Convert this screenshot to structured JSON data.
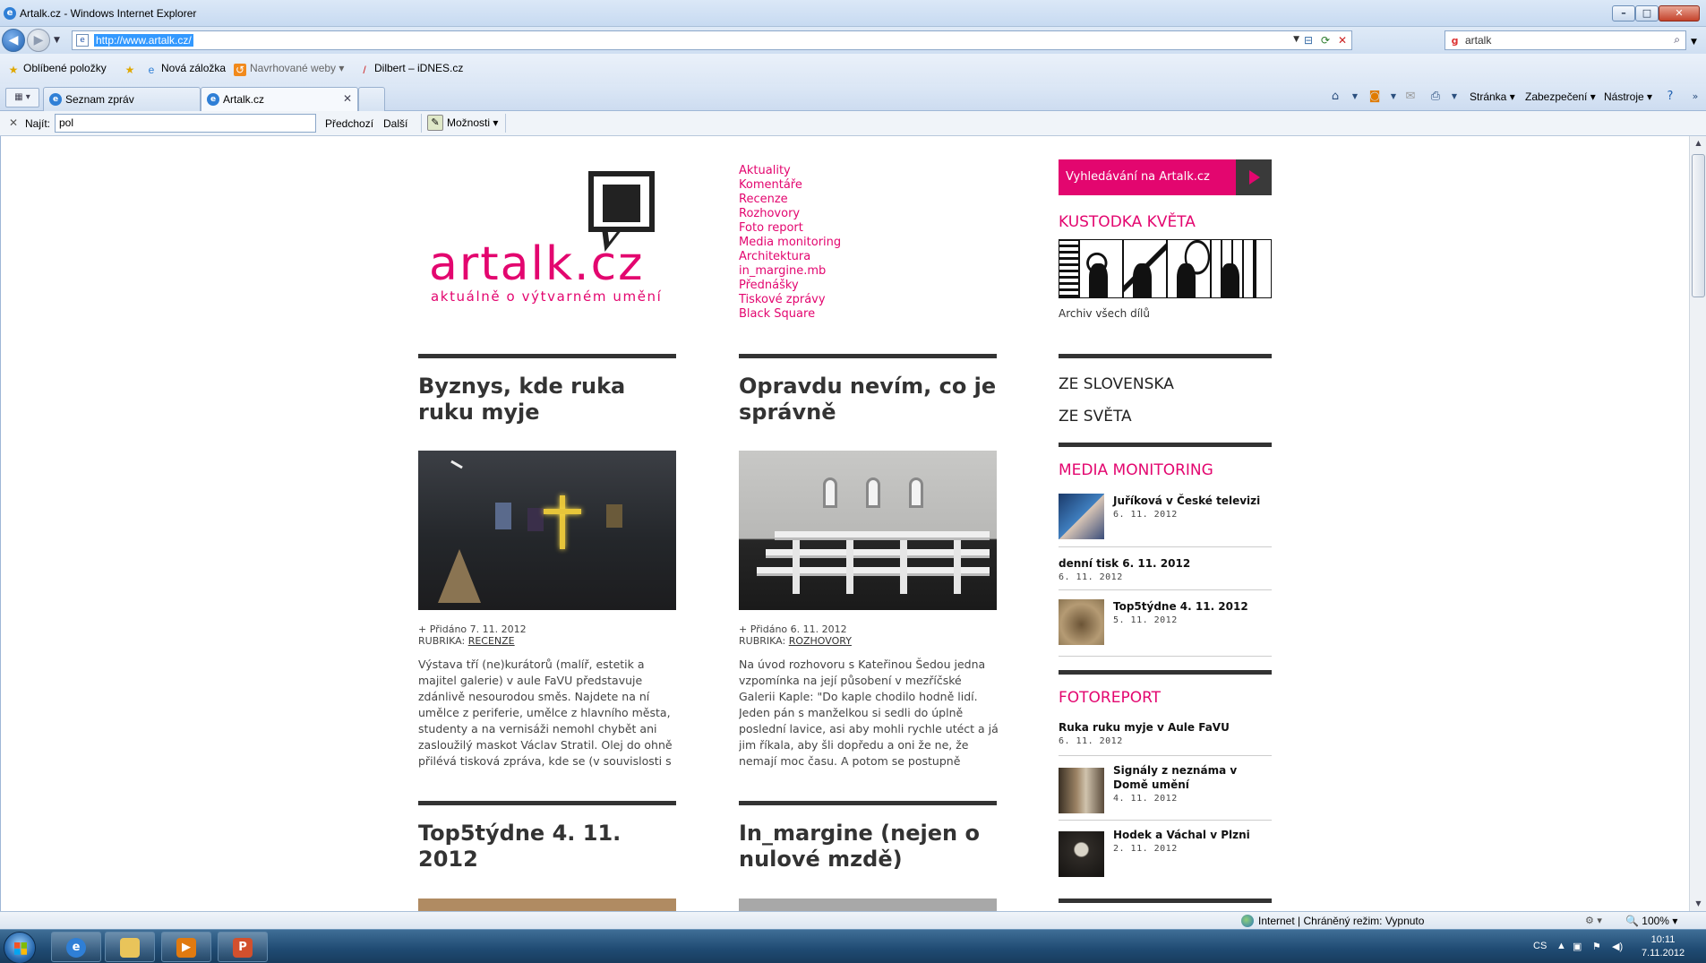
{
  "window": {
    "title": "Artalk.cz - Windows Internet Explorer"
  },
  "address": {
    "url": "http://www.artalk.cz/"
  },
  "search": {
    "value": "artalk"
  },
  "favorites": {
    "items": [
      {
        "label": "Oblíbené položky"
      },
      {
        "label": "Nová záložka"
      },
      {
        "label": "Navrhované weby"
      },
      {
        "label": "Dilbert – iDNES.cz"
      }
    ]
  },
  "tabs": [
    {
      "label": "Seznam zpráv"
    },
    {
      "label": "Artalk.cz"
    }
  ],
  "commandbar": {
    "page": "Stránka",
    "security": "Zabezpečení",
    "tools": "Nástroje"
  },
  "find": {
    "label": "Najít:",
    "value": "pol",
    "prev": "Předchozí",
    "next": "Další",
    "options": "Možnosti"
  },
  "site": {
    "logo": "artalk.cz",
    "tagline": "aktuálně o výtvarném umění",
    "nav": [
      "Aktuality",
      "Komentáře",
      "Recenze",
      "Rozhovory",
      "Foto report",
      "Media monitoring",
      "Architektura",
      "in_margine.mb",
      "Přednášky",
      "Tiskové zprávy",
      "Black Square"
    ],
    "search_label": "Vyhledávání na Artalk.cz",
    "kustodka": {
      "title": "KUSTODKA KVĚTA",
      "archive": "Archiv všech dílů"
    },
    "regions": [
      "ZE SLOVENSKA",
      "ZE SVĚTA"
    ],
    "media_monitoring": {
      "title": "MEDIA MONITORING",
      "items": [
        {
          "title": "Juříková v České televizi",
          "date": "6. 11. 2012"
        },
        {
          "title": "denní tisk 6. 11. 2012",
          "date": "6. 11. 2012"
        },
        {
          "title": "Top5týdne 4. 11. 2012",
          "date": "5. 11. 2012"
        }
      ]
    },
    "fotoreport": {
      "title": "FOTOREPORT",
      "items": [
        {
          "title": "Ruka ruku myje v Aule FaVU",
          "date": "6. 11. 2012"
        },
        {
          "title": "Signály z neznáma v Domě umění",
          "date": "4. 11. 2012"
        },
        {
          "title": "Hodek a Váchal v Plzni",
          "date": "2. 11. 2012"
        }
      ]
    },
    "articles": [
      {
        "title": "Byznys, kde ruka ruku myje",
        "added": "+ Přidáno 7. 11. 2012",
        "rubrika_label": "RUBRIKA:",
        "rubrika": "RECENZE",
        "text": "Výstava tří (ne)kurátorů (malíř, estetik a majitel galerie) v aule FaVU představuje zdánlivě nesourodou směs. Najdete na ní umělce z periferie, umělce z hlavního města, studenty a na vernisáži nemohl chybět ani zasloužilý maskot Václav Stratil. Olej do ohně přilévá tisková zpráva, kde se (v souvislosti s"
      },
      {
        "title": "Opravdu nevím, co je správně",
        "added": "+ Přidáno 6. 11. 2012",
        "rubrika_label": "RUBRIKA:",
        "rubrika": "ROZHOVORY",
        "text": "Na úvod rozhovoru s Kateřinou Šedou jedna vzpomínka na její působení v mezříčské Galerii Kaple: \"Do kaple chodilo hodně lidí. Jeden pán s manželkou si sedli do úplně poslední lavice, asi aby mohli rychle utéct a já jim říkala, aby šli dopředu a oni že ne, že nemají moc času. A potom se postupně"
      },
      {
        "title": "Top5týdne 4. 11. 2012"
      },
      {
        "title": "In_margine (nejen o nulové mzdě)"
      }
    ]
  },
  "status": {
    "zone": "Internet | Chráněný režim: Vypnuto",
    "zoom": "100%"
  },
  "taskbar": {
    "lang": "CS",
    "time": "10:11",
    "date": "7.11.2012"
  },
  "colors": {
    "accent": "#e3066f",
    "text": "#333333"
  }
}
